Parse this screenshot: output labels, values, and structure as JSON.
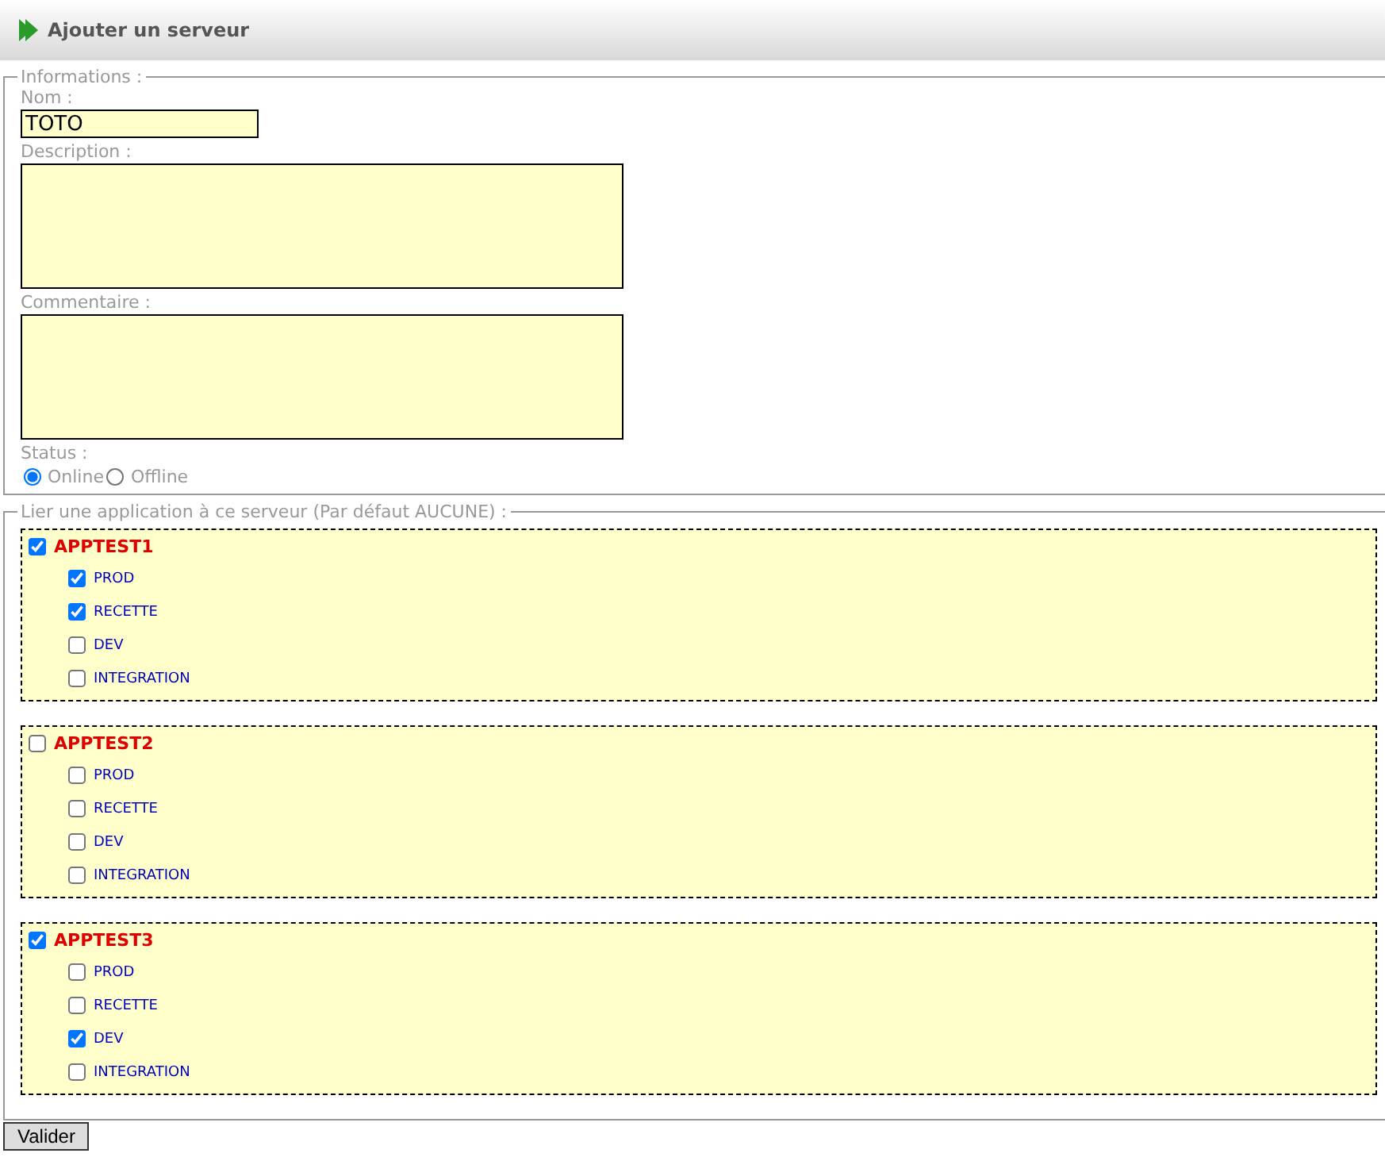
{
  "header": {
    "title": "Ajouter un serveur"
  },
  "informations": {
    "legend": "Informations :",
    "fields": [
      {
        "kind": "input",
        "label": "Nom :",
        "value": "TOTO"
      },
      {
        "kind": "textarea",
        "label": "Description :"
      },
      {
        "kind": "textarea",
        "label": "Commentaire :"
      }
    ],
    "status": {
      "label": "Status :",
      "options": [
        {
          "label": "Online",
          "selected": true
        },
        {
          "label": "Offline",
          "selected": false
        }
      ]
    }
  },
  "applications": {
    "legend": "Lier une application à ce serveur (Par défaut AUCUNE) :",
    "groups": [
      {
        "name": "APPTEST1",
        "checked": true,
        "envs": [
          {
            "label": "PROD",
            "checked": true
          },
          {
            "label": "RECETTE",
            "checked": true
          },
          {
            "label": "DEV",
            "checked": false
          },
          {
            "label": "INTEGRATION",
            "checked": false
          }
        ]
      },
      {
        "name": "APPTEST2",
        "checked": false,
        "envs": [
          {
            "label": "PROD",
            "checked": false
          },
          {
            "label": "RECETTE",
            "checked": false
          },
          {
            "label": "DEV",
            "checked": false
          },
          {
            "label": "INTEGRATION",
            "checked": false
          }
        ]
      },
      {
        "name": "APPTEST3",
        "checked": true,
        "envs": [
          {
            "label": "PROD",
            "checked": false
          },
          {
            "label": "RECETTE",
            "checked": false
          },
          {
            "label": "DEV",
            "checked": true
          },
          {
            "label": "INTEGRATION",
            "checked": false
          }
        ]
      }
    ]
  },
  "submit": "Valider"
}
